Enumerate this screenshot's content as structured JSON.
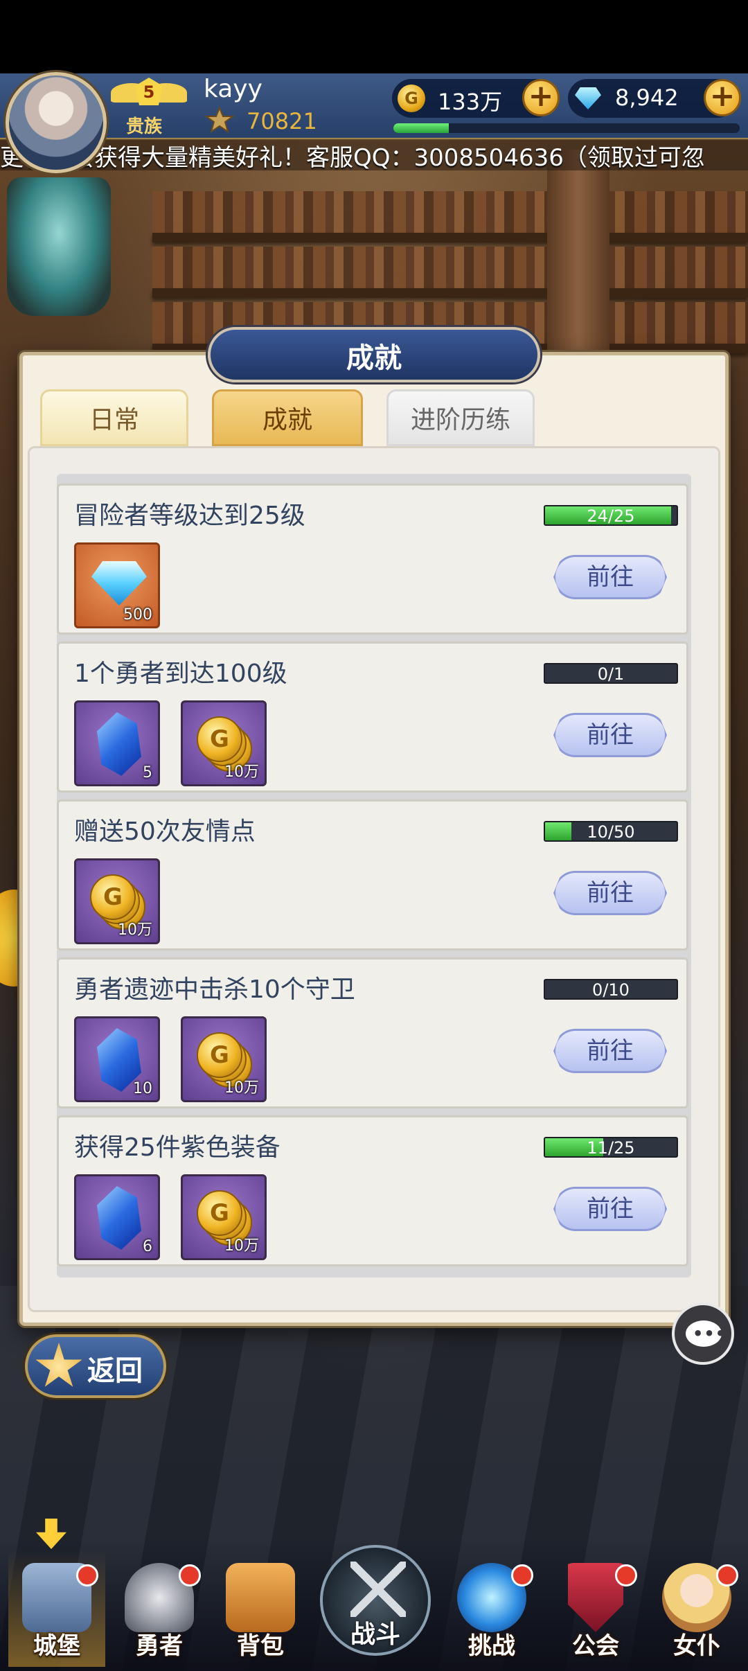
{
  "hud": {
    "noble_level": "5",
    "noble_label": "贵族",
    "username": "kayy",
    "power": "70821",
    "gold": "133万",
    "gems": "8,942",
    "xp_progress": 0.16,
    "marquee": "更有机会获得大量精美好礼！客服QQ：3008504636（领取过可忽"
  },
  "panel": {
    "title": "成就",
    "tabs": [
      {
        "label": "日常",
        "state": "normal"
      },
      {
        "label": "成就",
        "state": "active"
      },
      {
        "label": "进阶历练",
        "state": "gray"
      }
    ],
    "achievements": [
      {
        "title": "冒险者等级达到25级",
        "progress_text": "24/25",
        "progress": 0.96,
        "go": "前往",
        "rewards": [
          {
            "type": "diamond",
            "count": "500"
          }
        ]
      },
      {
        "title": "1个勇者到达100级",
        "progress_text": "0/1",
        "progress": 0.0,
        "go": "前往",
        "rewards": [
          {
            "type": "crystal",
            "count": "5"
          },
          {
            "type": "coin",
            "count": "10万"
          }
        ]
      },
      {
        "title": "赠送50次友情点",
        "progress_text": "10/50",
        "progress": 0.2,
        "go": "前往",
        "rewards": [
          {
            "type": "coin",
            "count": "10万"
          }
        ]
      },
      {
        "title": "勇者遗迹中击杀10个守卫",
        "progress_text": "0/10",
        "progress": 0.0,
        "go": "前往",
        "rewards": [
          {
            "type": "crystal",
            "count": "10"
          },
          {
            "type": "coin",
            "count": "10万"
          }
        ]
      },
      {
        "title": "获得25件紫色装备",
        "progress_text": "11/25",
        "progress": 0.44,
        "go": "前往",
        "rewards": [
          {
            "type": "crystal",
            "count": "6"
          },
          {
            "type": "coin",
            "count": "10万"
          }
        ]
      }
    ]
  },
  "back_label": "返回",
  "nav": {
    "castle": "城堡",
    "heroes": "勇者",
    "bag": "背包",
    "battle": "战斗",
    "challenge": "挑战",
    "guild": "公会",
    "maid": "女仆"
  },
  "colors": {
    "progress_green": "#2ea52e",
    "tab_active": "#e8b955",
    "hud_blue": "#27406a"
  }
}
